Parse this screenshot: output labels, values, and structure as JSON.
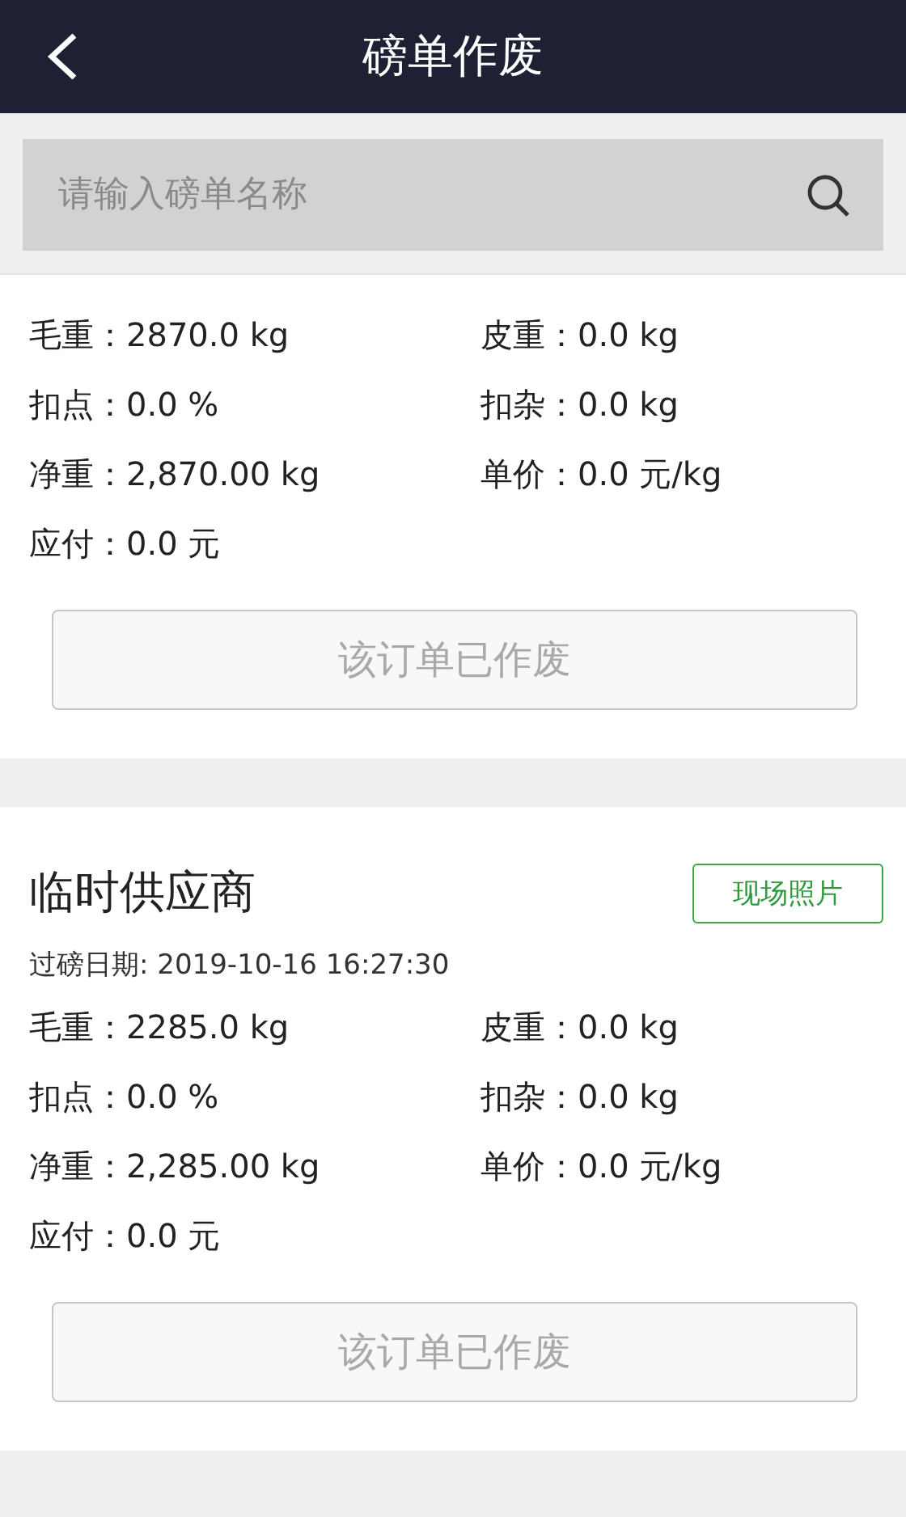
{
  "header": {
    "title": "磅单作废"
  },
  "search": {
    "placeholder": "请输入磅单名称"
  },
  "records": [
    {
      "fields": [
        {
          "label": "毛重：",
          "value": "2870.0 kg"
        },
        {
          "label": "皮重：",
          "value": "0.0 kg"
        },
        {
          "label": "扣点：",
          "value": "0.0 %"
        },
        {
          "label": "扣杂：",
          "value": "0.0 kg"
        },
        {
          "label": "净重：",
          "value": "2,870.00 kg"
        },
        {
          "label": "单价：",
          "value": "0.0 元/kg"
        },
        {
          "label": "应付：",
          "value": "0.0 元"
        }
      ],
      "status_button": {
        "label": "该订单已作废",
        "disabled": true
      }
    },
    {
      "supplier": "临时供应商",
      "photo_button": "现场照片",
      "date": "过磅日期: 2019-10-16 16:27:30",
      "fields": [
        {
          "label": "毛重：",
          "value": "2285.0 kg"
        },
        {
          "label": "皮重：",
          "value": "0.0 kg"
        },
        {
          "label": "扣点：",
          "value": "0.0 %"
        },
        {
          "label": "扣杂：",
          "value": "0.0 kg"
        },
        {
          "label": "净重：",
          "value": "2,285.00 kg"
        },
        {
          "label": "单价：",
          "value": "0.0 元/kg"
        },
        {
          "label": "应付：",
          "value": "0.0 元"
        }
      ],
      "status_button": {
        "label": "该订单已作废",
        "disabled": true
      }
    }
  ]
}
